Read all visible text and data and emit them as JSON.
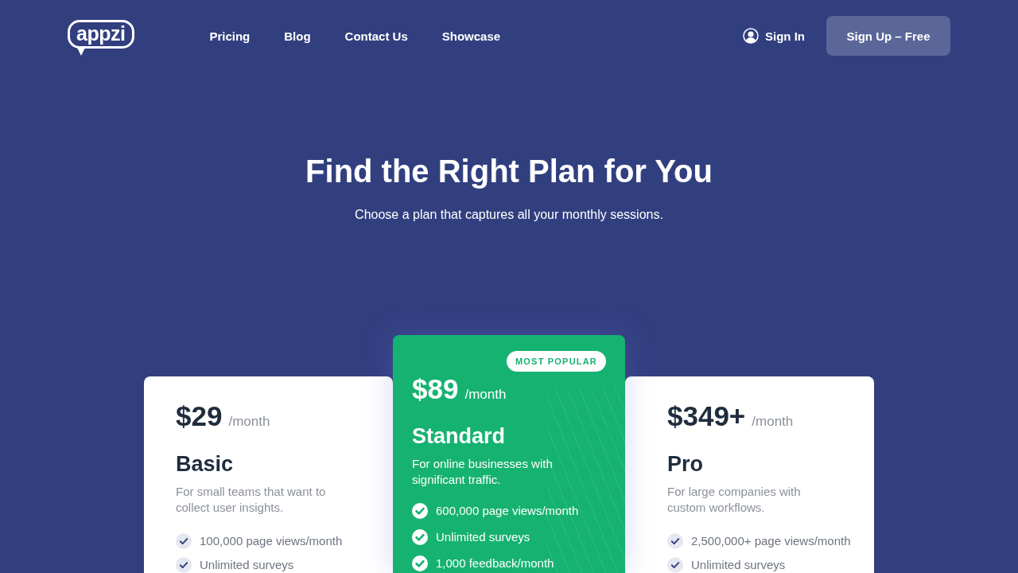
{
  "header": {
    "logo": "appzi",
    "nav": [
      "Pricing",
      "Blog",
      "Contact Us",
      "Showcase"
    ],
    "sign_in": "Sign In",
    "sign_up": "Sign Up – Free"
  },
  "hero": {
    "title": "Find the Right Plan for You",
    "subtitle": "Choose a plan that captures all your monthly sessions."
  },
  "plans": [
    {
      "kind": "plain",
      "price": "$29",
      "period": "/month",
      "name": "Basic",
      "description": "For small teams that want to collect user insights.",
      "features": [
        "100,000 page views/month",
        "Unlimited surveys"
      ]
    },
    {
      "kind": "featured",
      "badge": "MOST POPULAR",
      "price": "$89",
      "period": "/month",
      "name": "Standard",
      "description": "For online businesses with significant traffic.",
      "features": [
        "600,000 page views/month",
        "Unlimited surveys",
        "1,000 feedback/month"
      ]
    },
    {
      "kind": "plain",
      "price": "$349+",
      "period": "/month",
      "name": "Pro",
      "description": "For large companies with custom workflows.",
      "features": [
        "2,500,000+ page views/month",
        "Unlimited surveys"
      ]
    }
  ]
}
